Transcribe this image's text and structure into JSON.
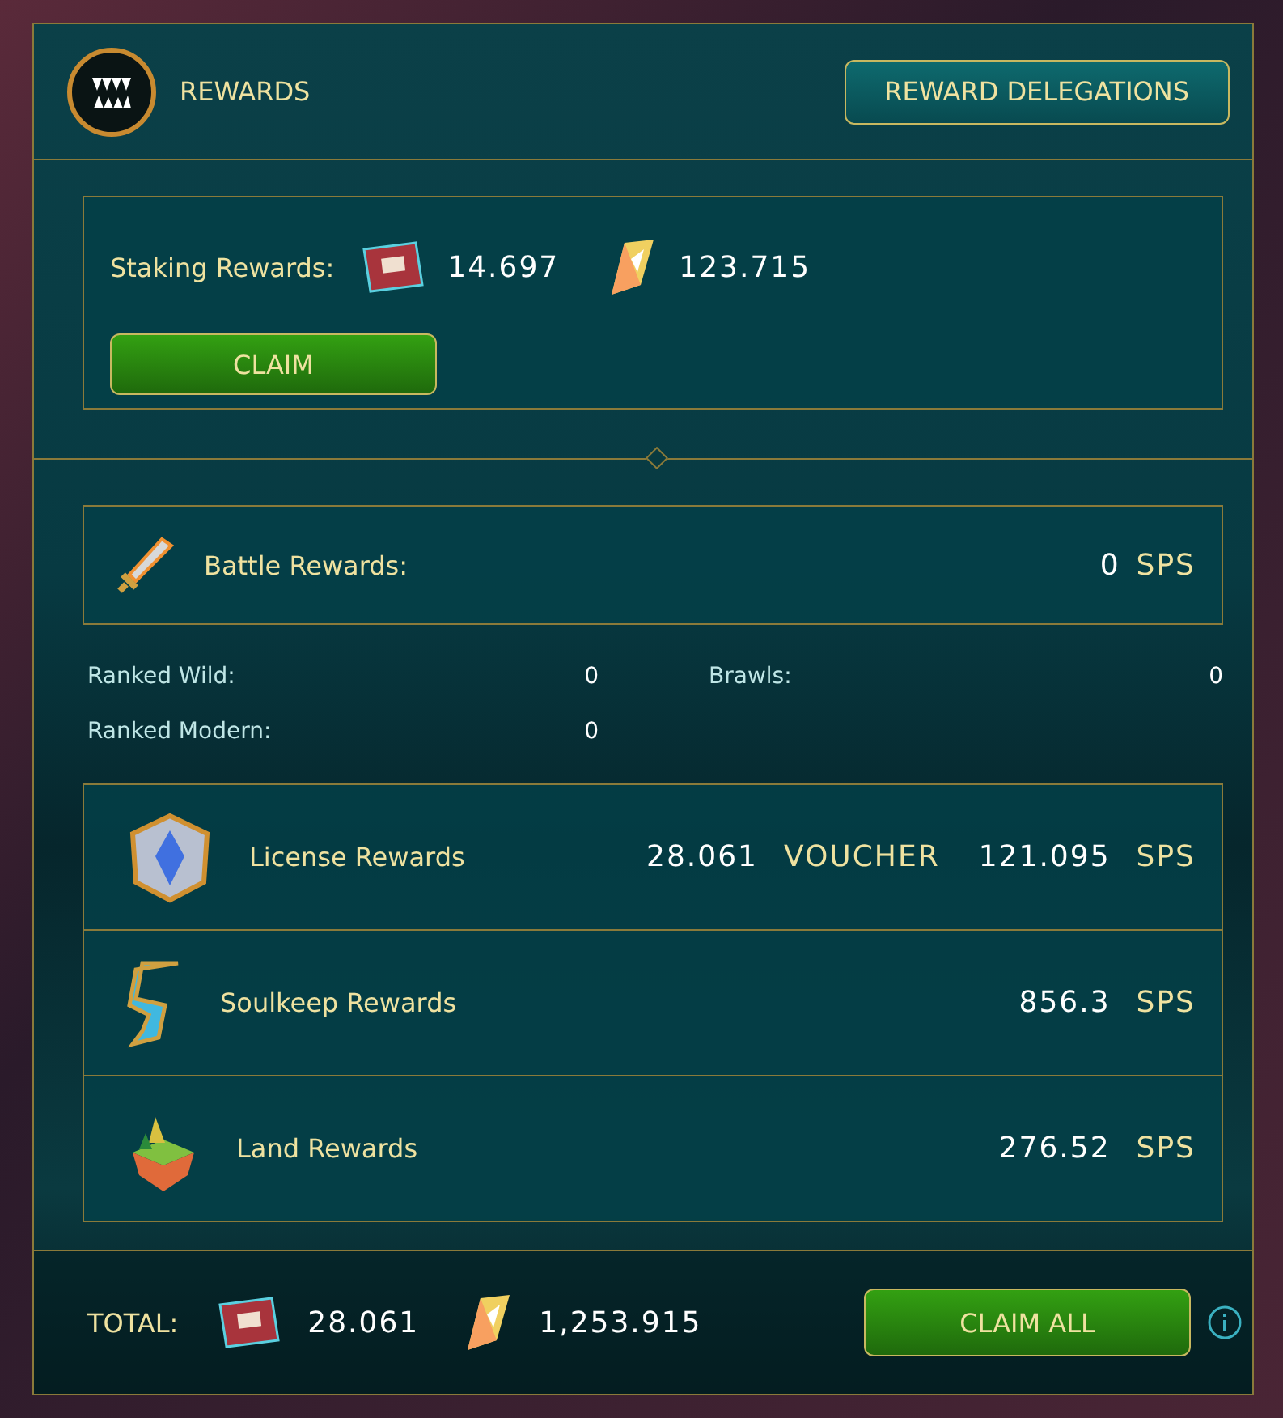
{
  "header": {
    "title": "REWARDS",
    "button": "REWARD DELEGATIONS"
  },
  "staking": {
    "label": "Staking Rewards:",
    "amounts": [
      {
        "kind": "voucher",
        "value": "14.697"
      },
      {
        "kind": "sps",
        "value": "123.715"
      }
    ],
    "button": "CLAIM"
  },
  "battle": {
    "label": "Battle Rewards:",
    "value": "0",
    "unit": "SPS"
  },
  "battle_stats": [
    {
      "label": "Ranked Wild:",
      "value": "0"
    },
    {
      "label": "Brawls:",
      "value": "0"
    },
    {
      "label": "Ranked Modern:",
      "value": "0"
    }
  ],
  "sources": [
    {
      "kind": "license",
      "label": "License Rewards",
      "amounts": [
        {
          "value": "28.061",
          "unit": "VOUCHER"
        },
        {
          "value": "121.095",
          "unit": "SPS"
        }
      ]
    },
    {
      "kind": "soulkeep",
      "label": "Soulkeep Rewards",
      "amounts": [
        {
          "value": "856.3",
          "unit": "SPS"
        }
      ]
    },
    {
      "kind": "land",
      "label": "Land Rewards",
      "amounts": [
        {
          "value": "276.52",
          "unit": "SPS"
        }
      ]
    }
  ],
  "total": {
    "label": "TOTAL:",
    "amounts": [
      {
        "kind": "voucher",
        "value": "28.061"
      },
      {
        "kind": "sps",
        "value": "1,253.915"
      }
    ],
    "button": "CLAIM ALL"
  }
}
